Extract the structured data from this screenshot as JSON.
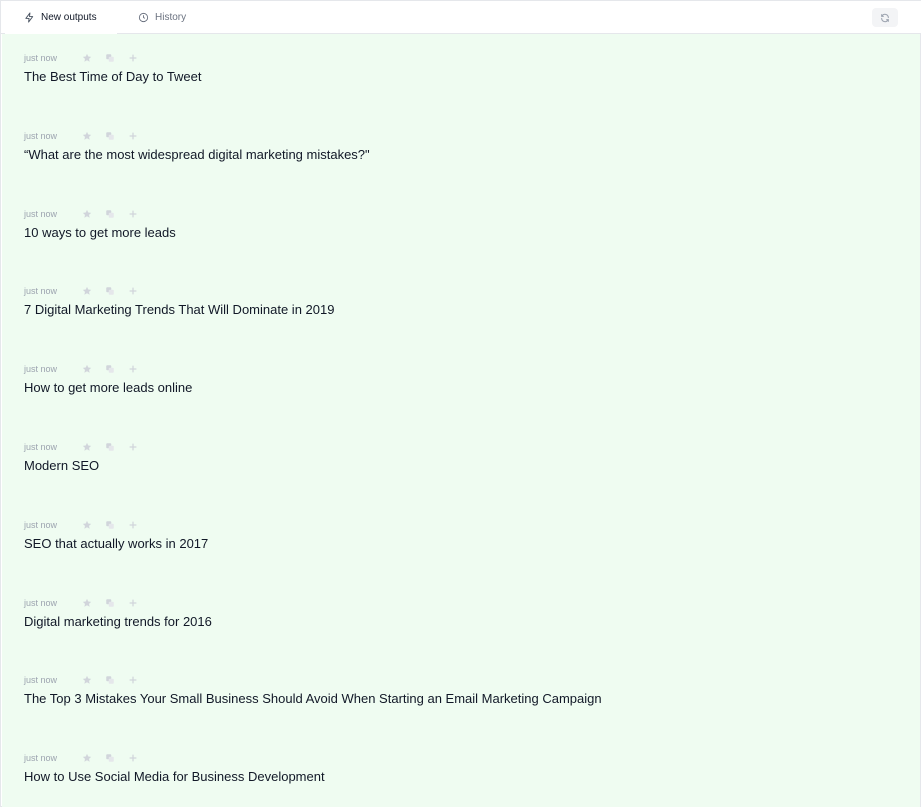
{
  "tabs": {
    "new_outputs": "New outputs",
    "history": "History"
  },
  "outputs": [
    {
      "time": "just now",
      "title": "The Best Time of Day to Tweet"
    },
    {
      "time": "just now",
      "title": "“What are the most widespread digital marketing mistakes?\""
    },
    {
      "time": "just now",
      "title": "10 ways to get more leads"
    },
    {
      "time": "just now",
      "title": "7 Digital Marketing Trends That Will Dominate in 2019"
    },
    {
      "time": "just now",
      "title": "How to get more leads online"
    },
    {
      "time": "just now",
      "title": "Modern SEO"
    },
    {
      "time": "just now",
      "title": "SEO that actually works in 2017"
    },
    {
      "time": "just now",
      "title": "Digital marketing trends for 2016"
    },
    {
      "time": "just now",
      "title": "The Top 3 Mistakes Your Small Business Should Avoid When Starting an Email Marketing Campaign"
    },
    {
      "time": "just now",
      "title": "How to Use Social Media for Business Development"
    }
  ],
  "icons": {
    "new_outputs": "lightning-icon",
    "history": "clock-icon",
    "refresh": "refresh-icon",
    "favorite": "star-icon",
    "copy": "copy-icon",
    "add": "plus-icon"
  },
  "colors": {
    "content_bg": "#effcf1",
    "action_icon": "#d1d5db",
    "muted_text": "#9ca3af"
  }
}
